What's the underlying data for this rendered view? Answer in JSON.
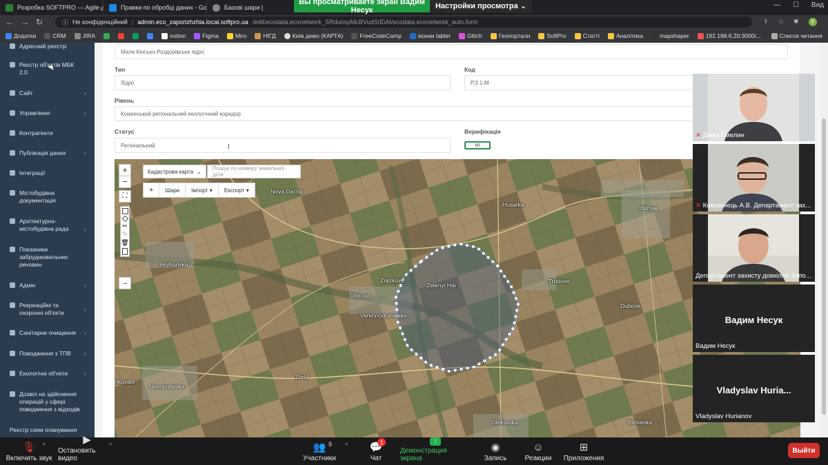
{
  "browser": {
    "tabs": [
      {
        "title": "Розробка SOFTPRO — Agile-до"
      },
      {
        "title": "Правки по обробці даних - Go"
      },
      {
        "title": "Базові шари |"
      }
    ],
    "address": {
      "security": "Не конфіденційний",
      "host": "admin.eco_zaporizhzhia.local.softpro.ua",
      "path": "/edit/ecodata.econetwork_SRduospMcBVudSrEiAl/ecodata.econetwork_auto.form"
    },
    "bookmarks": [
      "Додатки",
      "CRM",
      "JIRA",
      "notion",
      "Figma",
      "Miro",
      "НІГД",
      "Київ демо (КАРТА)",
      "FreeCodeCamp",
      "іконки tabler",
      "Glitch",
      "Геопортали",
      "SoftPro",
      "Статті",
      "Аналітика",
      "mapshaper",
      "192.168.6.20:3000/...",
      "Список читання"
    ]
  },
  "share_banner": {
    "watching": "Вы просматриваете экран Вадим Несук",
    "settings": "Настройки просмотра"
  },
  "window": {
    "view_label": "Вид"
  },
  "sidebar": {
    "items": [
      {
        "label": "Адресний реєстр",
        "chevron": true
      },
      {
        "label": "Реєстр об'єктів МБК 2.0",
        "chevron": false
      },
      {
        "label": "Сайт",
        "chevron": true
      },
      {
        "label": "Управління",
        "chevron": true
      },
      {
        "label": "Контрагенти",
        "chevron": false
      },
      {
        "label": "Публікація даних",
        "chevron": true
      },
      {
        "label": "Інтеграції",
        "chevron": false
      },
      {
        "label": "Містобудівна документація",
        "chevron": false
      },
      {
        "label": "Архітектурно-містобудівна рада",
        "chevron": true
      },
      {
        "label": "Показники забруднювальних речовин",
        "chevron": false
      },
      {
        "label": "Адмін",
        "chevron": true
      },
      {
        "label": "Рекреаційні та охоронні об'єкти",
        "chevron": true
      },
      {
        "label": "Санітарне очищення",
        "chevron": true
      },
      {
        "label": "Поводження з ТПВ",
        "chevron": true
      },
      {
        "label": "Екологічні об'єкти",
        "chevron": true
      },
      {
        "label": "Дозвіл на здійснення операцій у сфері поводження з відходів",
        "chevron": false
      },
      {
        "label": "Реєстр схем планування",
        "chevron": false
      }
    ]
  },
  "form": {
    "name_value": "Мале Кінсько-Роздорівське ядро",
    "type_label": "Тип",
    "type_value": "Ядро",
    "code_label": "Код",
    "code_value": "Р.3.1-М",
    "level_label": "Рівень",
    "level_value": "Конкіеський регіональний екологічний коридор",
    "status_label": "Статус",
    "status_value": "Регіональний",
    "verify_label": "Верифікація",
    "verify_value": "НІ"
  },
  "map": {
    "layer_select": "Кадастрова карта",
    "search_placeholder": "Пошук по номеру земельної діля",
    "toolbar": {
      "layers": "Шари",
      "import": "Імпорт ▾",
      "export": "Експорт ▾"
    },
    "places": [
      "Nova Dacha",
      "Husarka",
      "Bilmak",
      "Hryhorivka",
      "Zrazkove",
      "Zelenyi Hai",
      "Dibrova",
      "Trudove",
      "Verkhnodrahivske",
      "Dubove",
      "Novopoltavka",
      "Zoria",
      "nkuvate",
      "Oleksiivka",
      "Bilmanka"
    ]
  },
  "participants": [
    {
      "name": "Дима Емелин",
      "muted": true
    },
    {
      "name": "Компанієць А.В. Департамент зах...",
      "muted": true
    },
    {
      "name": "Департамент захисту довкілля Запо...",
      "muted": false
    },
    {
      "name": "Вадим Несук",
      "display": "Вадим Несук",
      "muted": false
    },
    {
      "name": "Vladyslav Hurianov",
      "display": "Vladyslav  Huria...",
      "muted": false
    }
  ],
  "zoom_bar": {
    "mute": "Включить звук",
    "video": "Остановить видео",
    "participants": "Участники",
    "participants_count": "9",
    "chat": "Чат",
    "chat_badge": "1",
    "share": "Демонстрация экрана",
    "record": "Запись",
    "reactions": "Реакции",
    "apps": "Приложения",
    "leave": "Выйти"
  }
}
